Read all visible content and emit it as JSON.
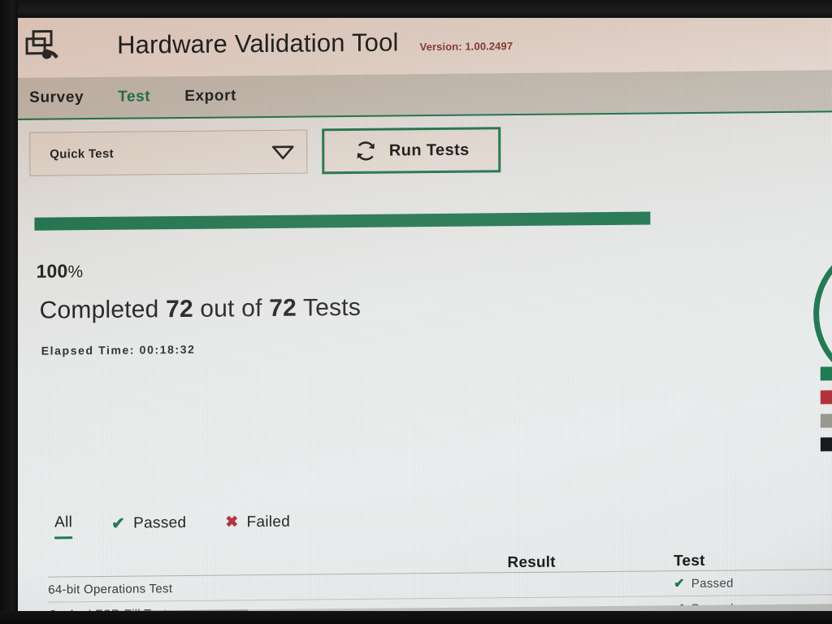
{
  "header": {
    "icon": "app-window-wrench-icon",
    "title": "Hardware Validation Tool",
    "version_label": "Version:",
    "version_value": "1.00.2497",
    "version_text": "Version: 1.00.2497"
  },
  "nav": {
    "tabs": [
      {
        "label": "Survey",
        "active": false
      },
      {
        "label": "Test",
        "active": true
      },
      {
        "label": "Export",
        "active": false
      }
    ]
  },
  "toolbar": {
    "test_select": {
      "value": "Quick Test",
      "caret_icon": "triangle-down-icon"
    },
    "run_button": {
      "label": "Run Tests",
      "icon": "refresh-icon"
    }
  },
  "progress": {
    "percent_value": "100",
    "percent_unit": "%",
    "percent_number": 100,
    "bar_fill_ratio": 0.79,
    "completed_prefix": "Completed",
    "completed_count": "72",
    "completed_middle": "out of",
    "total_count": "72",
    "completed_suffix": "Tests",
    "elapsed_text": "Elapsed Time: 00:18:32"
  },
  "summary_chart": {
    "type": "donut",
    "legend": [
      {
        "name": "passed-swatch",
        "color": "#1f7a52"
      },
      {
        "name": "failed-swatch",
        "color": "#b5303a"
      },
      {
        "name": "skipped-swatch",
        "color": "#9b9b93"
      },
      {
        "name": "other-swatch",
        "color": "#17171c"
      }
    ],
    "arc_color": "#1f7a52"
  },
  "results": {
    "filters": [
      {
        "label": "All",
        "icon": null,
        "active": true
      },
      {
        "label": "Passed",
        "icon": "check-icon",
        "active": false
      },
      {
        "label": "Failed",
        "icon": "cross-icon",
        "active": false
      }
    ],
    "columns": {
      "name": "",
      "result": "Result",
      "test": "Test"
    },
    "rows": [
      {
        "name": "64-bit Operations Test",
        "result": "",
        "test": "Passed",
        "test_icon": "check-icon"
      },
      {
        "name": "Cache LFSR Fill Test",
        "result": "",
        "test": "Passed",
        "test_icon": "check-icon"
      }
    ]
  },
  "colors": {
    "accent_green": "#1f7a52",
    "error_red": "#b5303a",
    "version_red": "#8e3b34",
    "header_bg": "#f4eeea",
    "nav_bg": "#cfcdc6",
    "screen_bg": "#eef1f1"
  }
}
